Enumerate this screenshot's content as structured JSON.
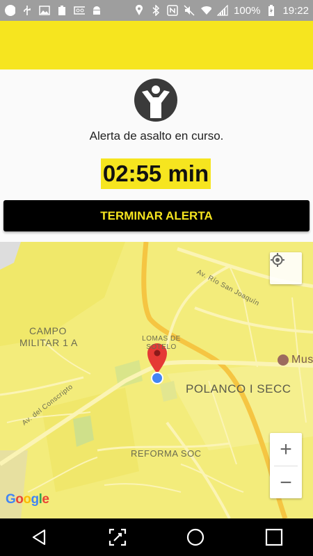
{
  "status_bar": {
    "battery": "100%",
    "time": "19:22",
    "icons": [
      "circle-icon",
      "usb-icon",
      "image-icon",
      "battery-100-icon",
      "voicemail-icon",
      "android-icon",
      "location-icon",
      "bluetooth-icon",
      "nfc-icon",
      "mute-icon",
      "wifi-icon",
      "signal-icon",
      "battery-charging-icon"
    ]
  },
  "alert": {
    "message": "Alerta de asalto en curso.",
    "timer": "02:55 min",
    "end_button": "TERMINAR ALERTA",
    "accent_color": "#f6e51f"
  },
  "map": {
    "labels": {
      "campo_1": "CAMPO",
      "campo_2": "MILITAR 1 A",
      "lomas": "LOMAS DE SOTELO",
      "polanco": "POLANCO I SECC",
      "reforma": "REFORMA SOC",
      "rio_san_joaquin": "Av. Río San Joaquín",
      "conscripto": "Av. del Conscripto",
      "museo": "Mus"
    },
    "zoom_in": "+",
    "zoom_out": "−",
    "attribution": "Google"
  },
  "nav": {
    "buttons": [
      "back-icon",
      "screenshot-icon",
      "home-icon",
      "recents-icon"
    ]
  }
}
